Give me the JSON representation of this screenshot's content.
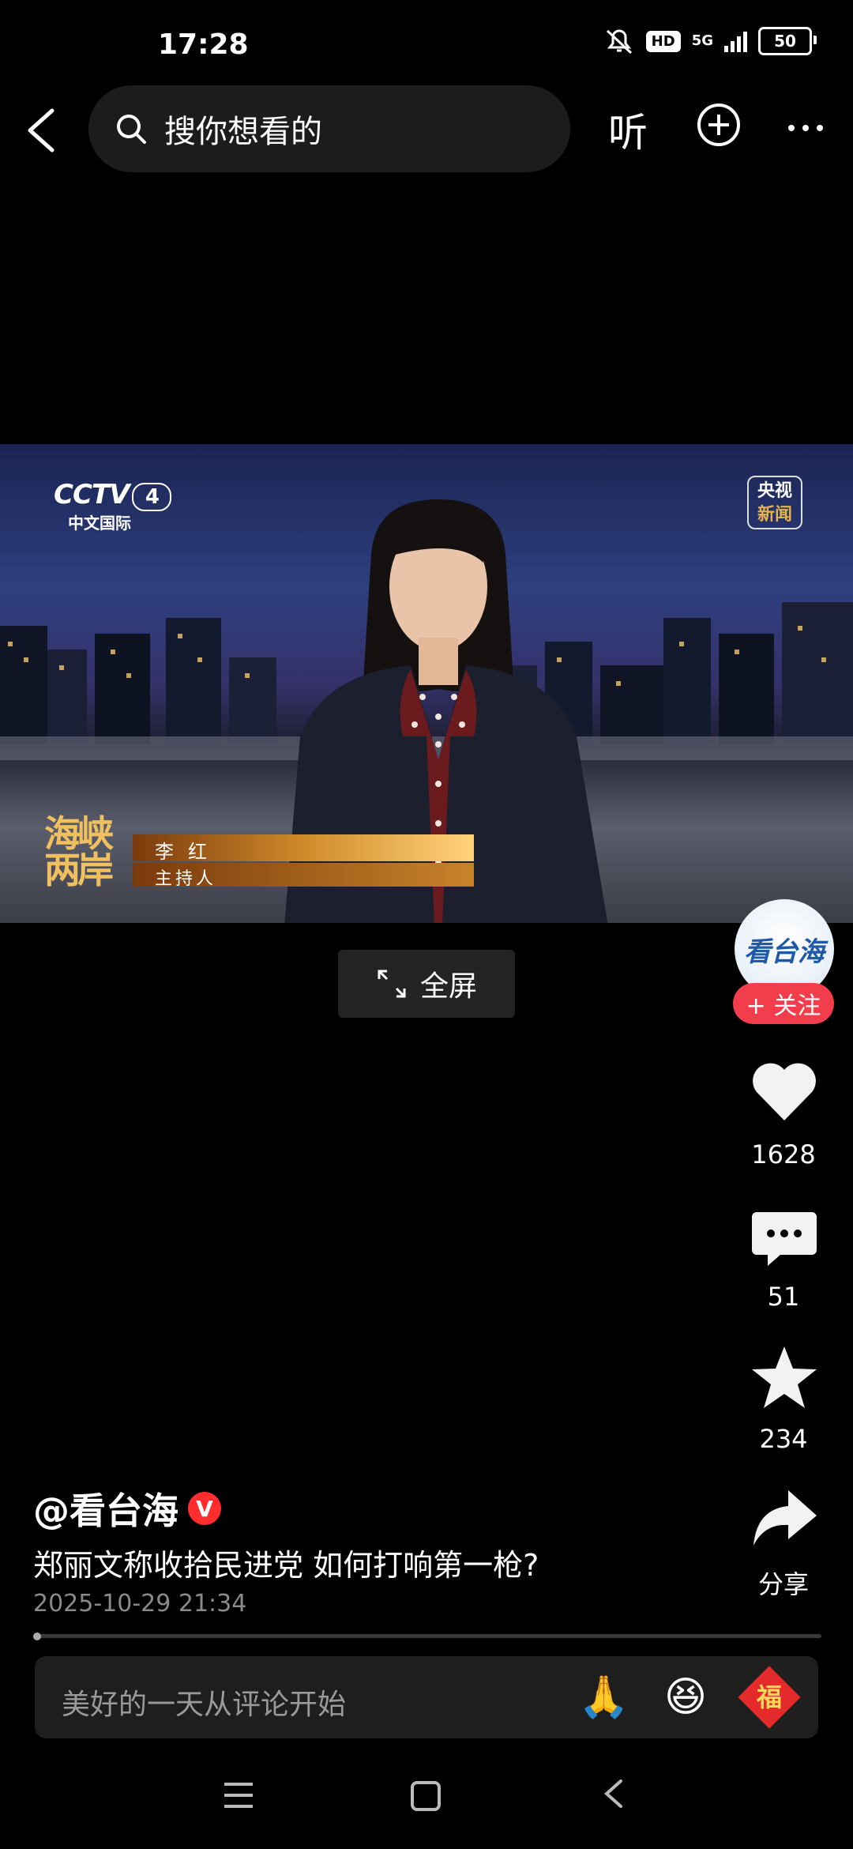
{
  "status_bar": {
    "time": "17:28",
    "hd": "HD",
    "network": "5G",
    "battery": "50"
  },
  "top_bar": {
    "search_placeholder": "搜你想看的",
    "listen_label": "听"
  },
  "video": {
    "channel_logo": "CCTV",
    "channel_number": "4",
    "channel_sub": "中文国际",
    "corner_logo_line1": "央视",
    "corner_logo_line2": "新闻",
    "show_logo_line1": "海峡",
    "show_logo_line2": "两岸",
    "anchor_name": "李红",
    "anchor_role": "主持人",
    "fullscreen_label": "全屏"
  },
  "rail": {
    "avatar_text": "看台海",
    "follow_label": "+ 关注",
    "likes": "1628",
    "comments": "51",
    "favorites": "234",
    "share_label": "分享"
  },
  "post": {
    "author": "@看台海",
    "verified_badge": "V",
    "caption": "郑丽文称收拾民进党 如何打响第一枪?",
    "date": "2025-10-29 21:34"
  },
  "comment_bar": {
    "placeholder": "美好的一天从评论开始",
    "emoji_1": "🙏",
    "emoji_2": "😆",
    "emoji_3": "福"
  }
}
